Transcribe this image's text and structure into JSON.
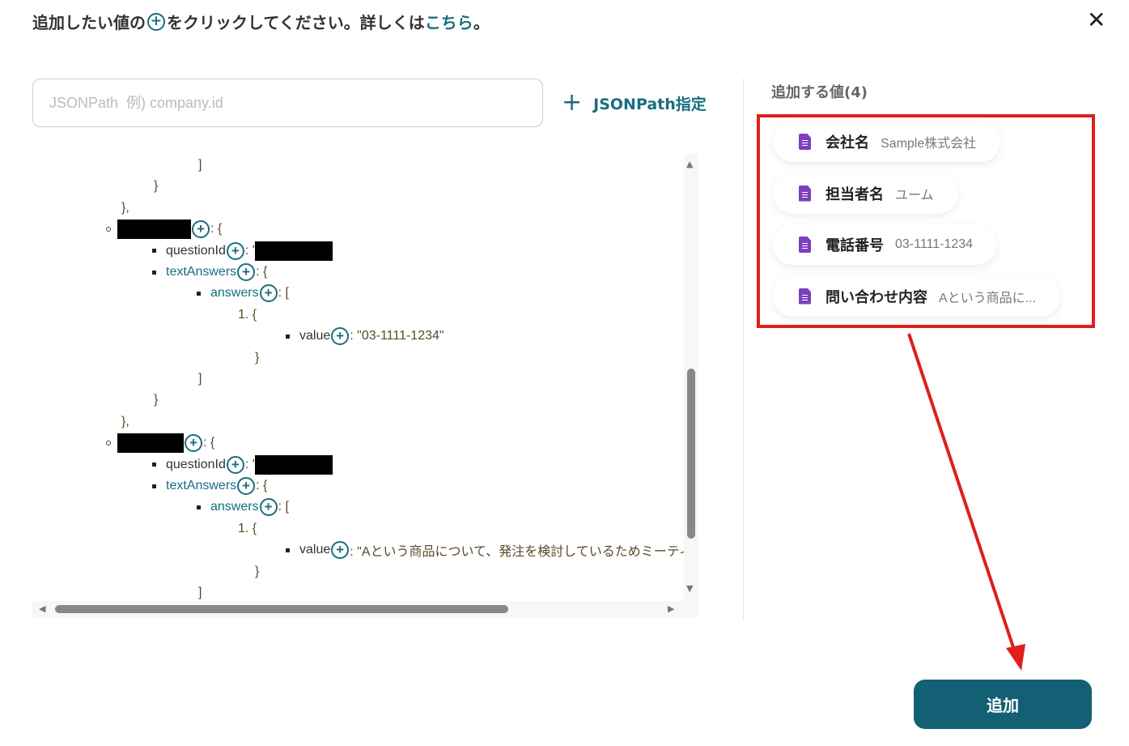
{
  "header": {
    "title_pre": "追加したい値の",
    "title_mid": "をクリックしてください。詳しくは",
    "title_link": "こちら",
    "title_end": "。",
    "close": "✕"
  },
  "search": {
    "placeholder": "JSONPath  例) company.id",
    "value": ""
  },
  "add_path": {
    "icon": "+",
    "label": "JSONPath指定"
  },
  "tree": [
    {
      "t": "text",
      "lvl": 3,
      "text": "]"
    },
    {
      "t": "text",
      "lvl": 2,
      "text": "}"
    },
    {
      "t": "text",
      "lvl": 1,
      "text": "},"
    },
    {
      "t": "obj",
      "key": "",
      "after": ": {",
      "redW": 91
    },
    {
      "t": "prop",
      "lvl": 2,
      "key": "questionId",
      "after": ": '",
      "redact": true
    },
    {
      "t": "prop",
      "lvl": 2,
      "key": "textAnswers",
      "teal": true,
      "after": ": {"
    },
    {
      "t": "prop",
      "lvl": 3,
      "key": "answers",
      "teal": true,
      "after": ": ["
    },
    {
      "t": "text",
      "lvl": 4,
      "text": "1. {"
    },
    {
      "t": "prop",
      "lvl": 6,
      "key": "value",
      "after": ": \"03-1111-1234\""
    },
    {
      "t": "text",
      "lvl": 5,
      "text": "}"
    },
    {
      "t": "text",
      "lvl": 3,
      "text": "]"
    },
    {
      "t": "text",
      "lvl": 2,
      "text": "}"
    },
    {
      "t": "text",
      "lvl": 1,
      "text": "},"
    },
    {
      "t": "obj",
      "key": "",
      "after": ": {",
      "redW": 82
    },
    {
      "t": "prop",
      "lvl": 2,
      "key": "questionId",
      "after": ": '",
      "redact": true
    },
    {
      "t": "prop",
      "lvl": 2,
      "key": "textAnswers",
      "teal": true,
      "after": ": {"
    },
    {
      "t": "prop",
      "lvl": 3,
      "key": "answers",
      "teal": true,
      "after": ": ["
    },
    {
      "t": "text",
      "lvl": 4,
      "text": "1. {"
    },
    {
      "t": "prop",
      "lvl": 6,
      "key": "value",
      "after": ": \"Aという商品について、発注を検討しているためミーティングを"
    },
    {
      "t": "text",
      "lvl": 5,
      "text": "}"
    },
    {
      "t": "text",
      "lvl": 3,
      "text": "]"
    }
  ],
  "selected": {
    "title": "追加する値(4)",
    "items": [
      {
        "key": "会社名",
        "value": "Sample株式会社"
      },
      {
        "key": "担当者名",
        "value": "ユーム"
      },
      {
        "key": "電話番号",
        "value": "03-1111-1234"
      },
      {
        "key": "問い合わせ内容",
        "value": "Aという商品に..."
      }
    ]
  },
  "submit": "追加",
  "colors": {
    "accent": "#135f73",
    "highlight": "#e01e1e",
    "form_icon": "#7b3fbf"
  }
}
